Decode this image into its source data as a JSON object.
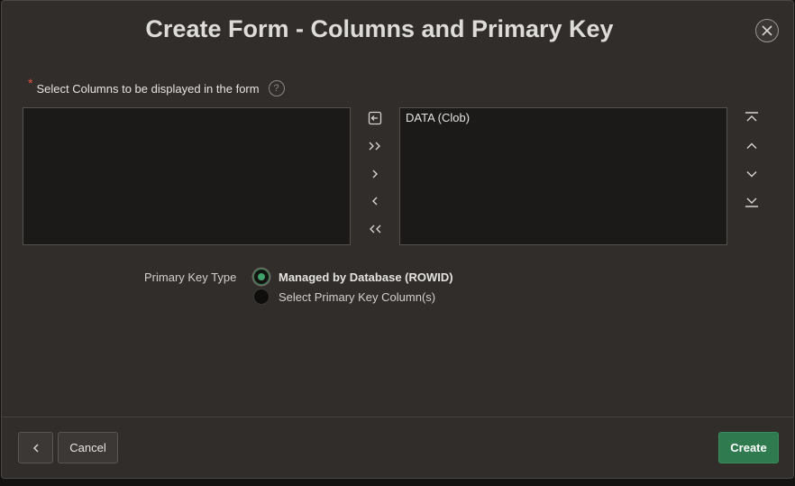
{
  "dialog": {
    "title": "Create Form - Columns and Primary Key",
    "close_icon": "close-icon"
  },
  "columns": {
    "required_marker": "*",
    "label": "Select Columns to be displayed in the form",
    "help_glyph": "?",
    "available_items": [],
    "selected_items": [
      "DATA (Clob)"
    ],
    "controls": {
      "reset": "reset-icon",
      "move_all": ">>",
      "move": ">",
      "remove": "<",
      "remove_all": "<<",
      "top": "move-top-icon",
      "up": "move-up-icon",
      "down": "move-down-icon",
      "bottom": "move-bottom-icon"
    }
  },
  "primary_key": {
    "label": "Primary Key Type",
    "options": [
      {
        "label": "Managed by Database (ROWID)",
        "checked": true
      },
      {
        "label": "Select Primary Key Column(s)",
        "checked": false
      }
    ]
  },
  "footer": {
    "back_icon": "chevron-left-icon",
    "cancel_label": "Cancel",
    "create_label": "Create"
  },
  "colors": {
    "dialog_bg": "#302d2a",
    "list_bg": "#1c1a19",
    "accent_green": "#2f7a4e",
    "required_red": "#e5533d"
  }
}
